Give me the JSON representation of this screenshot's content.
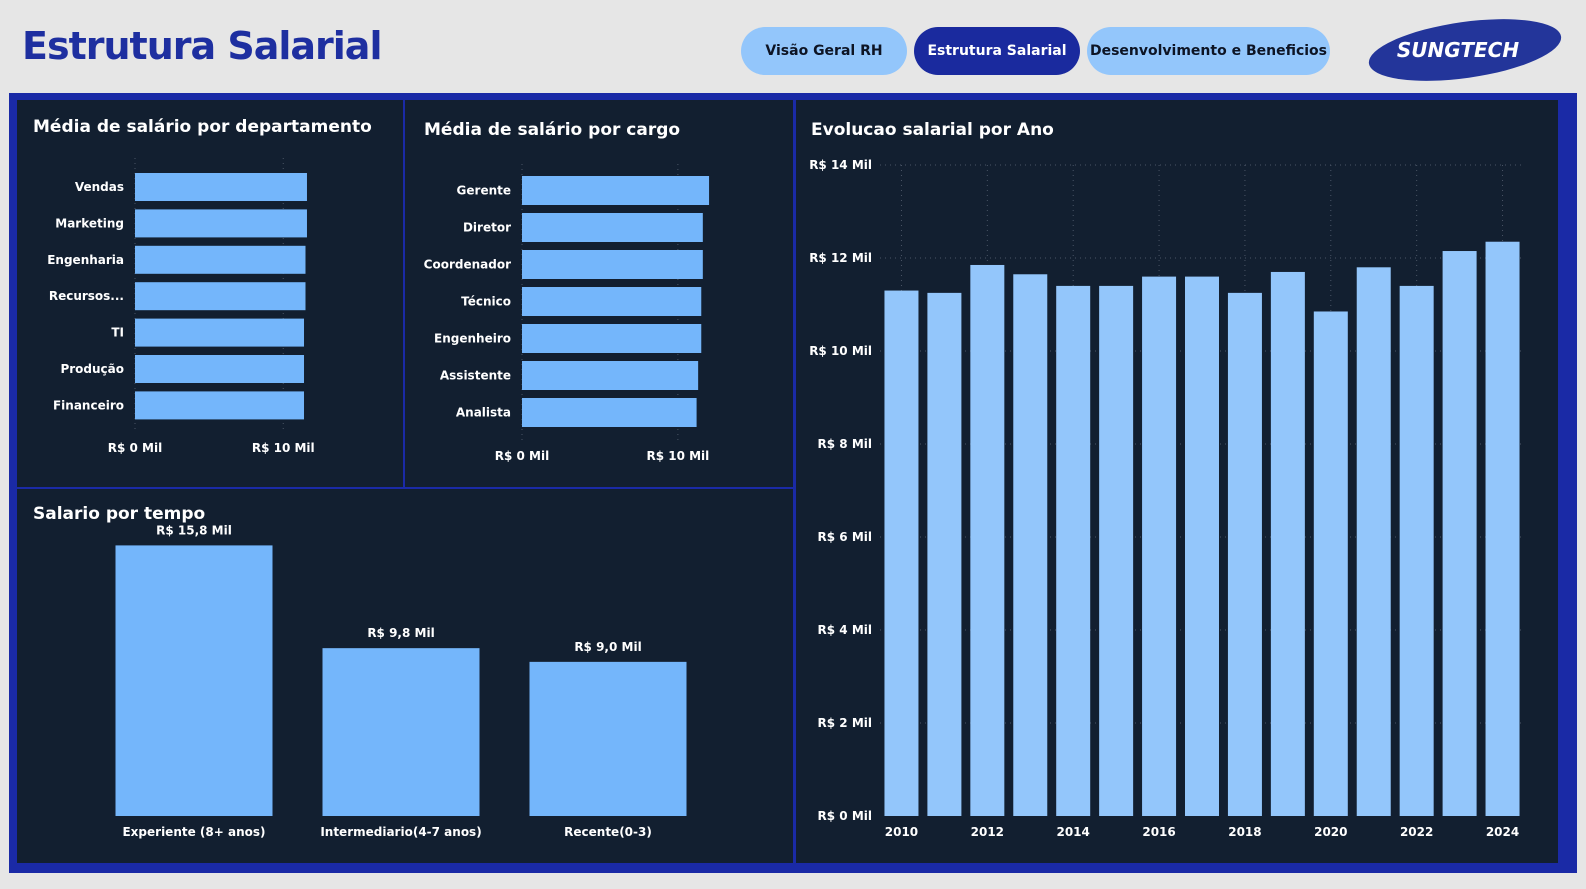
{
  "header": {
    "title": "Estrutura Salarial",
    "tabs": [
      {
        "label": "Visão Geral RH",
        "active": false
      },
      {
        "label": "Estrutura Salarial",
        "active": true
      },
      {
        "label": "Desenvolvimento e Beneficios",
        "active": false
      }
    ],
    "logo_text": "SUNGTECH"
  },
  "colors": {
    "accent": "#1a2a9e",
    "panel_bg": "#121f30",
    "bar": "#74b6fb",
    "bar_light": "#93c6fb"
  },
  "charts": {
    "dept": {
      "title": "Média de salário por departamento"
    },
    "cargo": {
      "title": "Média de salário por cargo"
    },
    "tempo": {
      "title": "Salario por tempo"
    },
    "ano": {
      "title": "Evolucao salarial por Ano"
    }
  },
  "chart_data": [
    {
      "id": "dept",
      "type": "bar",
      "orientation": "horizontal",
      "title": "Média de salário por departamento",
      "categories": [
        "Vendas",
        "Marketing",
        "Engenharia",
        "Recursos...",
        "TI",
        "Produção",
        "Financeiro"
      ],
      "values": [
        11.6,
        11.6,
        11.5,
        11.5,
        11.4,
        11.4,
        11.4
      ],
      "unit": "R$ Mil",
      "xlim": [
        0,
        17.2
      ],
      "ticks": [
        {
          "value": 0,
          "label": "R$ 0 Mil"
        },
        {
          "value": 10,
          "label": "R$ 10 Mil"
        }
      ]
    },
    {
      "id": "cargo",
      "type": "bar",
      "orientation": "horizontal",
      "title": "Média de salário por cargo",
      "categories": [
        "Gerente",
        "Diretor",
        "Coordenador",
        "Técnico",
        "Engenheiro",
        "Assistente",
        "Analista"
      ],
      "values": [
        12.0,
        11.6,
        11.6,
        11.5,
        11.5,
        11.3,
        11.2
      ],
      "unit": "R$ Mil",
      "xlim": [
        0,
        17.0
      ],
      "ticks": [
        {
          "value": 0,
          "label": "R$ 0 Mil"
        },
        {
          "value": 10,
          "label": "R$ 10 Mil"
        }
      ]
    },
    {
      "id": "tempo",
      "type": "bar",
      "title": "Salario por tempo",
      "categories": [
        "Experiente (8+ anos)",
        "Intermediario(4-7 anos)",
        "Recente(0-3)"
      ],
      "values": [
        15.8,
        9.8,
        9.0
      ],
      "data_labels": [
        "R$ 15,8 Mil",
        "R$ 9,8 Mil",
        "R$ 9,0 Mil"
      ],
      "unit": "R$ Mil"
    },
    {
      "id": "ano",
      "type": "bar",
      "title": "Evolucao salarial por Ano",
      "categories": [
        "2010",
        "2011",
        "2012",
        "2013",
        "2014",
        "2015",
        "2016",
        "2017",
        "2018",
        "2019",
        "2020",
        "2021",
        "2022",
        "2023",
        "2024"
      ],
      "values": [
        11.3,
        11.25,
        11.85,
        11.65,
        11.4,
        11.4,
        11.6,
        11.6,
        11.25,
        11.7,
        10.85,
        11.8,
        11.4,
        12.15,
        12.35
      ],
      "x_tick_labels": [
        "2010",
        "",
        "2012",
        "",
        "2014",
        "",
        "2016",
        "",
        "2018",
        "",
        "2020",
        "",
        "2022",
        "",
        "2024"
      ],
      "unit": "R$ Mil",
      "ylim": [
        0,
        14
      ],
      "y_ticks": [
        {
          "value": 0,
          "label": "R$ 0 Mil"
        },
        {
          "value": 2,
          "label": "R$ 2 Mil"
        },
        {
          "value": 4,
          "label": "R$ 4 Mil"
        },
        {
          "value": 6,
          "label": "R$ 6 Mil"
        },
        {
          "value": 8,
          "label": "R$ 8 Mil"
        },
        {
          "value": 10,
          "label": "R$ 10 Mil"
        },
        {
          "value": 12,
          "label": "R$ 12 Mil"
        },
        {
          "value": 14,
          "label": "R$ 14 Mil"
        }
      ],
      "grid": true
    }
  ]
}
